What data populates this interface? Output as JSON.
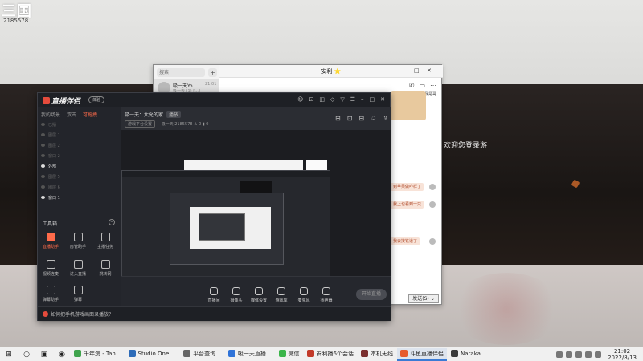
{
  "desktop": {
    "corner_logo": "三国",
    "corner_sub": "2185578",
    "welcome": "欢迎您登录游"
  },
  "chat": {
    "search_placeholder": "搜索",
    "plus": "+",
    "contact_name": "吸一天Yo",
    "contact_time": "21:01",
    "contact_preview": "吸一天 (1) [...]",
    "title": "安利",
    "title_star": "⭐",
    "win_min": "–",
    "win_max": "□",
    "win_close": "✕",
    "msg_1": "我是哥",
    "bubble_1": "到苹果做咋样了",
    "bubble_2": "我上也看到一只",
    "bubble_3": "我去接铁道了",
    "send_label": "发送(S)",
    "send_arrow": "⌄"
  },
  "app": {
    "logo": "直播伴侣",
    "badge": "体验",
    "top_icons": [
      "☺",
      "⊡",
      "◫",
      "◇",
      "▽",
      "☰",
      "–",
      "□",
      "✕"
    ],
    "tabs": [
      "我的场景",
      "双击",
      "可拖拽"
    ],
    "scenes": [
      "已播",
      "图层 1",
      "图层 2",
      "窗口 2",
      "外部",
      "图层 5",
      "图层 6",
      "窗口 1"
    ],
    "tools_title": "工具箱",
    "tools_close": "–",
    "tools": [
      "直播助手",
      "房管助手",
      "主播任务",
      "视频连麦",
      "进入直播",
      "跳转网",
      "弹幕助手",
      "弹幕"
    ],
    "room_title": "吸一天：大允的家",
    "room_tag": "播放",
    "room_category": "游戏平台设置",
    "room_user": "吸一天",
    "room_id": "2185578",
    "room_stats": "♙ 0  ▮ 0",
    "stage_icons": [
      "⊞",
      "⊡",
      "⊟",
      "♤",
      "⇪"
    ],
    "bottom_tools": [
      "直播间",
      "摄像头",
      "媒体设置",
      "游戏库",
      "麦克风",
      "扬声器"
    ],
    "go_live": "开始直播",
    "status_tip": "如何把手机游戏画面录播放？"
  },
  "taskbar": {
    "apps": [
      {
        "label": "千年浣 - Tan...",
        "color": "#3fa34d"
      },
      {
        "label": "Studio One ...",
        "color": "#2d6bb8"
      },
      {
        "label": "平台查询...",
        "color": "#666666"
      },
      {
        "label": "吸一天直播...",
        "color": "#2f73d8"
      },
      {
        "label": "微信",
        "color": "#3bb54a"
      },
      {
        "label": "安利播6个会话",
        "color": "#c23a2a"
      },
      {
        "label": "本机无线",
        "color": "#7a2e2e"
      },
      {
        "label": "斗鱼直播伴侣",
        "color": "#e65a2e"
      },
      {
        "label": "Naraka",
        "color": "#3a3a3a"
      }
    ],
    "clock_time": "21:02",
    "clock_date": "2022/8/13"
  }
}
